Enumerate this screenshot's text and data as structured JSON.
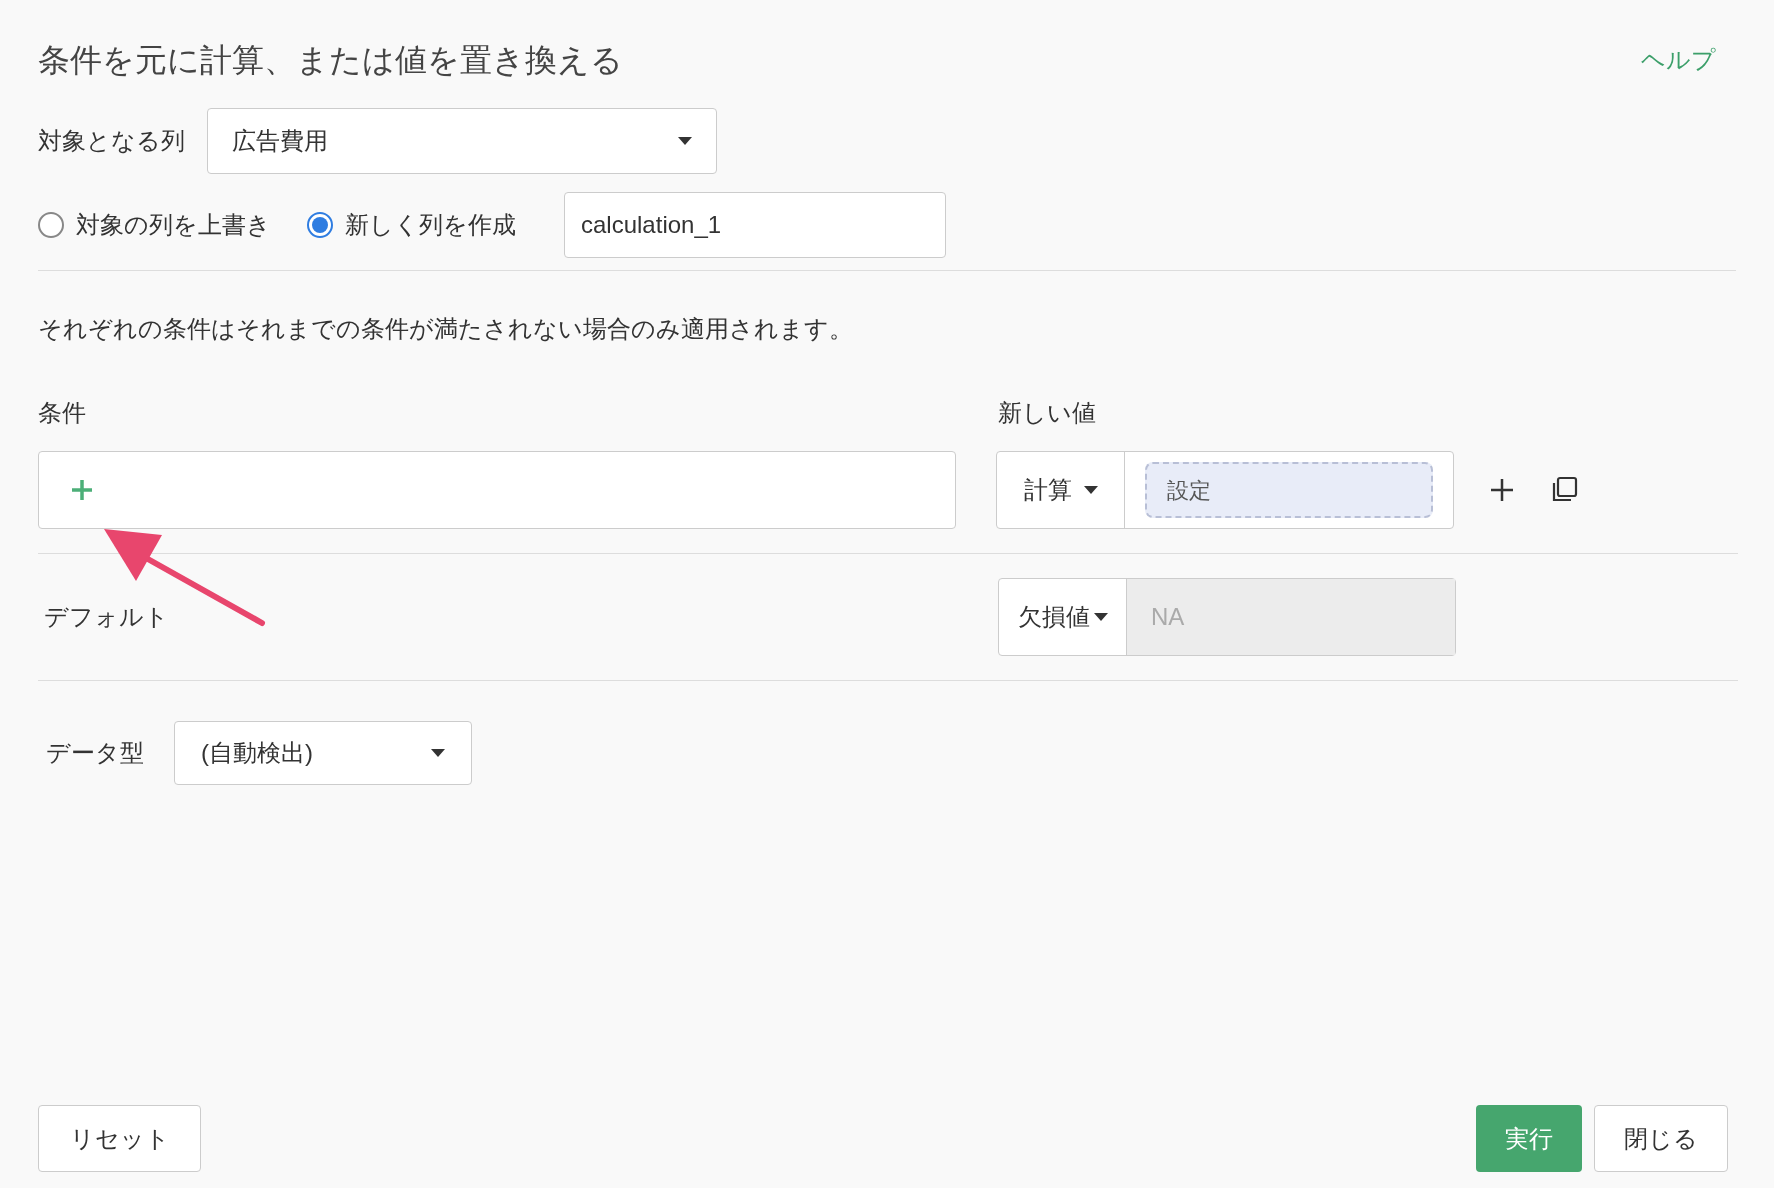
{
  "title": "条件を元に計算、または値を置き換える",
  "help_link": "ヘルプ",
  "target_column": {
    "label": "対象となる列",
    "value": "広告費用"
  },
  "modes": [
    {
      "label": "対象の列を上書き",
      "selected": false
    },
    {
      "label": "新しく列を作成",
      "selected": true
    }
  ],
  "new_column_name": {
    "value": "calculation_1"
  },
  "note": "それぞれの条件はそれまでの条件が満たされない場合のみ適用されます。",
  "conditions": {
    "label": "条件",
    "new_value_label": "新しい値",
    "rows": [
      {
        "value_type": "計算",
        "value_button": "設定"
      }
    ]
  },
  "default": {
    "label": "デフォルト",
    "value_type": "欠損値",
    "value": "NA",
    "disabled": true
  },
  "data_type": {
    "label": "データ型",
    "value": "(自動検出)"
  },
  "buttons": {
    "reset": "リセット",
    "run": "実行",
    "close": "閉じる"
  }
}
